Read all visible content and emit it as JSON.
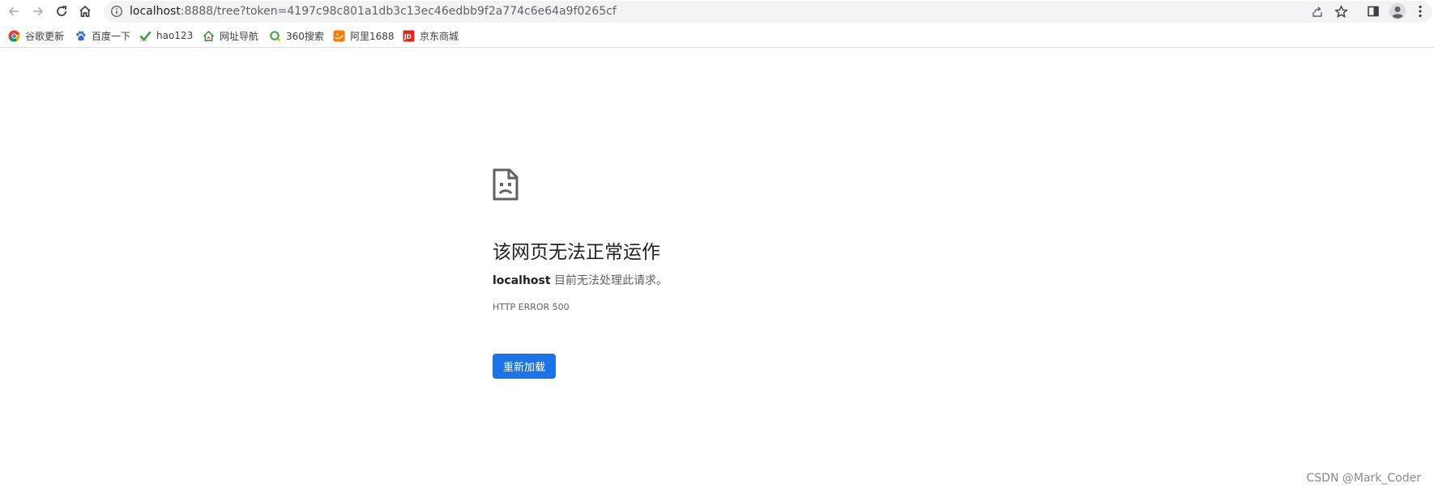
{
  "browser": {
    "url_host": "localhost",
    "url_rest": ":8888/tree?token=4197c98c801a1db3c13ec46edbb9f2a774c6e64a9f0265cf",
    "icons": [
      "back-arrow-icon",
      "forward-arrow-icon",
      "reload-icon",
      "home-icon",
      "info-icon",
      "share-icon",
      "star-icon",
      "side-panel-icon",
      "profile-avatar-icon",
      "menu-dots-icon"
    ]
  },
  "bookmarks": [
    {
      "label": "谷歌更新",
      "icon": "chrome-icon"
    },
    {
      "label": "百度一下",
      "icon": "baidu-paw-icon"
    },
    {
      "label": "hao123",
      "icon": "hao123-icon"
    },
    {
      "label": "网址导航",
      "icon": "house-icon"
    },
    {
      "label": "360搜索",
      "icon": "360-search-icon"
    },
    {
      "label": "阿里1688",
      "icon": "alibaba-1688-icon"
    },
    {
      "label": "京东商城",
      "icon": "jd-icon"
    }
  ],
  "error": {
    "icon": "sad-document-icon",
    "title": "该网页无法正常运作",
    "host": "localhost",
    "message": " 目前无法处理此请求。",
    "code": "HTTP ERROR 500",
    "reload_label": "重新加载"
  },
  "watermark": "CSDN @Mark_Coder",
  "colors": {
    "accent": "#1a73e8",
    "omnibox_bg": "#f1f3f4",
    "text_primary": "#202124",
    "text_secondary": "#5f6368"
  }
}
